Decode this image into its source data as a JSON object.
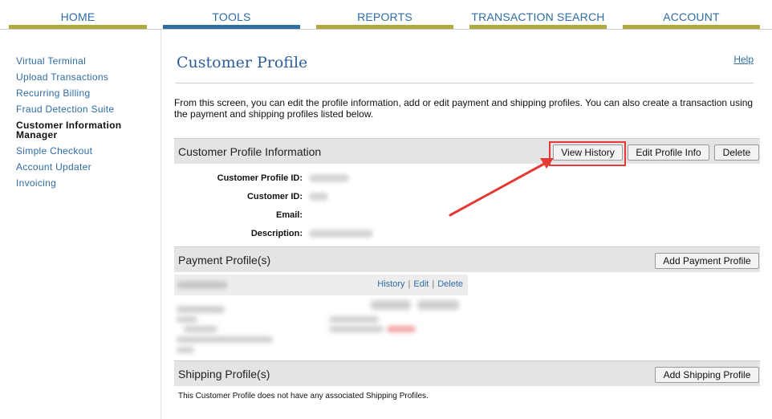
{
  "nav": {
    "tabs": [
      {
        "label": "HOME"
      },
      {
        "label": "TOOLS"
      },
      {
        "label": "REPORTS"
      },
      {
        "label": "TRANSACTION SEARCH"
      },
      {
        "label": "ACCOUNT"
      }
    ],
    "active_tab": "TOOLS"
  },
  "sidebar": {
    "items": [
      {
        "label": "Virtual Terminal"
      },
      {
        "label": "Upload Transactions"
      },
      {
        "label": "Recurring Billing"
      },
      {
        "label": "Fraud Detection Suite"
      },
      {
        "label": "Customer Information Manager"
      },
      {
        "label": "Simple Checkout"
      },
      {
        "label": "Account Updater"
      },
      {
        "label": "Invoicing"
      }
    ],
    "active_item": "Customer Information Manager"
  },
  "main": {
    "title": "Customer Profile",
    "help_label": "Help",
    "intro": "From this screen, you can edit the profile information, add or edit payment and shipping profiles. You can also create a transaction using the payment and shipping profiles listed below.",
    "profile_section": {
      "title": "Customer Profile Information",
      "buttons": {
        "view_history": "View History",
        "edit_profile": "Edit Profile Info",
        "delete": "Delete"
      },
      "fields": [
        {
          "label": "Customer Profile ID:",
          "value_redacted": true
        },
        {
          "label": "Customer ID:",
          "value_redacted": true
        },
        {
          "label": "Email:",
          "value_redacted": false
        },
        {
          "label": "Description:",
          "value_redacted": true
        }
      ]
    },
    "payment_section": {
      "title": "Payment Profile(s)",
      "add_button": "Add Payment Profile",
      "links": {
        "history": "History",
        "edit": "Edit",
        "delete": "Delete"
      },
      "separator": "|"
    },
    "shipping_section": {
      "title": "Shipping Profile(s)",
      "add_button": "Add Shipping Profile",
      "empty_message": "This Customer Profile does not have any associated Shipping Profiles."
    }
  },
  "colors": {
    "nav_text": "#2e6ca4",
    "nav_underline": "#b0a93b",
    "nav_active_underline": "#2e6ca4",
    "title": "#2e5f94",
    "section_bg": "#e4e4e4",
    "annotation": "#e53935"
  },
  "annotation": {
    "highlighted": "View History"
  }
}
